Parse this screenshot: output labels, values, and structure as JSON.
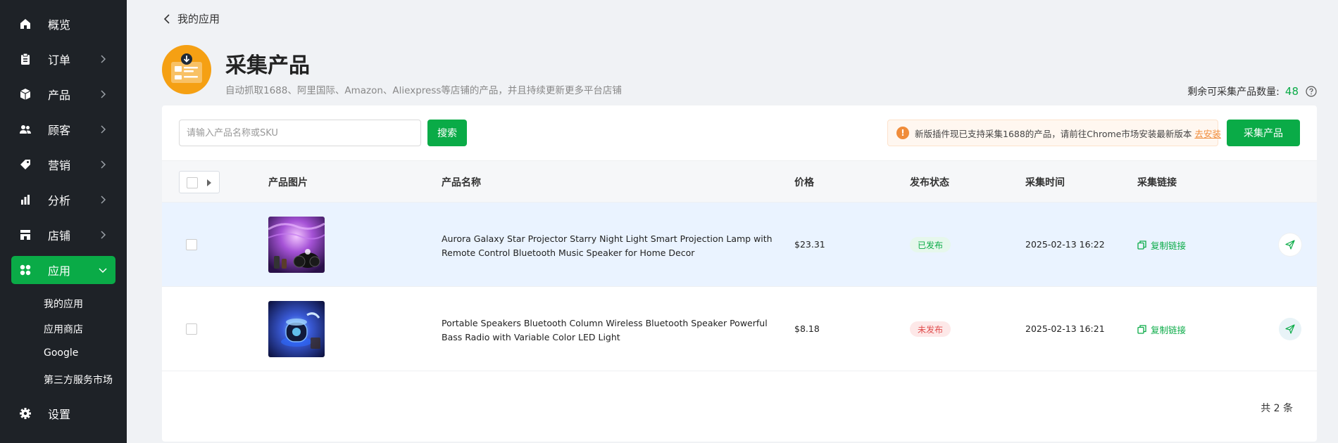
{
  "sidebar": {
    "items": [
      {
        "label": "概览",
        "icon": "home-icon"
      },
      {
        "label": "订单",
        "icon": "clipboard-icon"
      },
      {
        "label": "产品",
        "icon": "box-icon"
      },
      {
        "label": "顾客",
        "icon": "users-icon"
      },
      {
        "label": "营销",
        "icon": "tag-icon"
      },
      {
        "label": "分析",
        "icon": "bar-chart-icon"
      },
      {
        "label": "店铺",
        "icon": "store-icon"
      },
      {
        "label": "应用",
        "icon": "grid-icon"
      }
    ],
    "subitems": [
      "我的应用",
      "应用商店",
      "Google",
      "第三方服务市场"
    ],
    "settings": {
      "label": "设置",
      "icon": "gear-icon"
    },
    "active_color": "#0aab47"
  },
  "header": {
    "back_label": "我的应用",
    "title": "采集产品",
    "subtitle": "自动抓取1688、阿里国际、Amazon、Aliexpress等店铺的产品，并且持续更新更多平台店铺",
    "quota_label": "剩余可采集产品数量:",
    "quota_value": "48"
  },
  "toolbar": {
    "search_placeholder": "请输入产品名称或SKU",
    "search_button": "搜索",
    "notice_text": "新版插件现已支持采集1688的产品，请前往Chrome市场安装最新版本",
    "notice_link": "去安装",
    "collect_button": "采集产品"
  },
  "table": {
    "headers": {
      "image": "产品图片",
      "name": "产品名称",
      "price": "价格",
      "status": "发布状态",
      "time": "采集时间",
      "link": "采集链接"
    },
    "rows": [
      {
        "name": "Aurora Galaxy Star Projector Starry Night Light Smart Projection Lamp with Remote Control Bluetooth Music Speaker for Home Decor",
        "price": "$23.31",
        "status": "已发布",
        "time": "2025-02-13 16:22",
        "link_label": "复制链接"
      },
      {
        "name": "Portable Speakers Bluetooth Column Wireless Bluetooth Speaker Powerful Bass Radio with Variable Color LED Light",
        "price": "$8.18",
        "status": "未发布",
        "time": "2025-02-13 16:21",
        "link_label": "复制链接"
      }
    ]
  },
  "footer": {
    "total": "共 2 条"
  },
  "colors": {
    "primary": "#0aab47",
    "warning": "#f08c3a",
    "danger": "#e04b4b",
    "sidebar_bg": "#1e2227"
  }
}
